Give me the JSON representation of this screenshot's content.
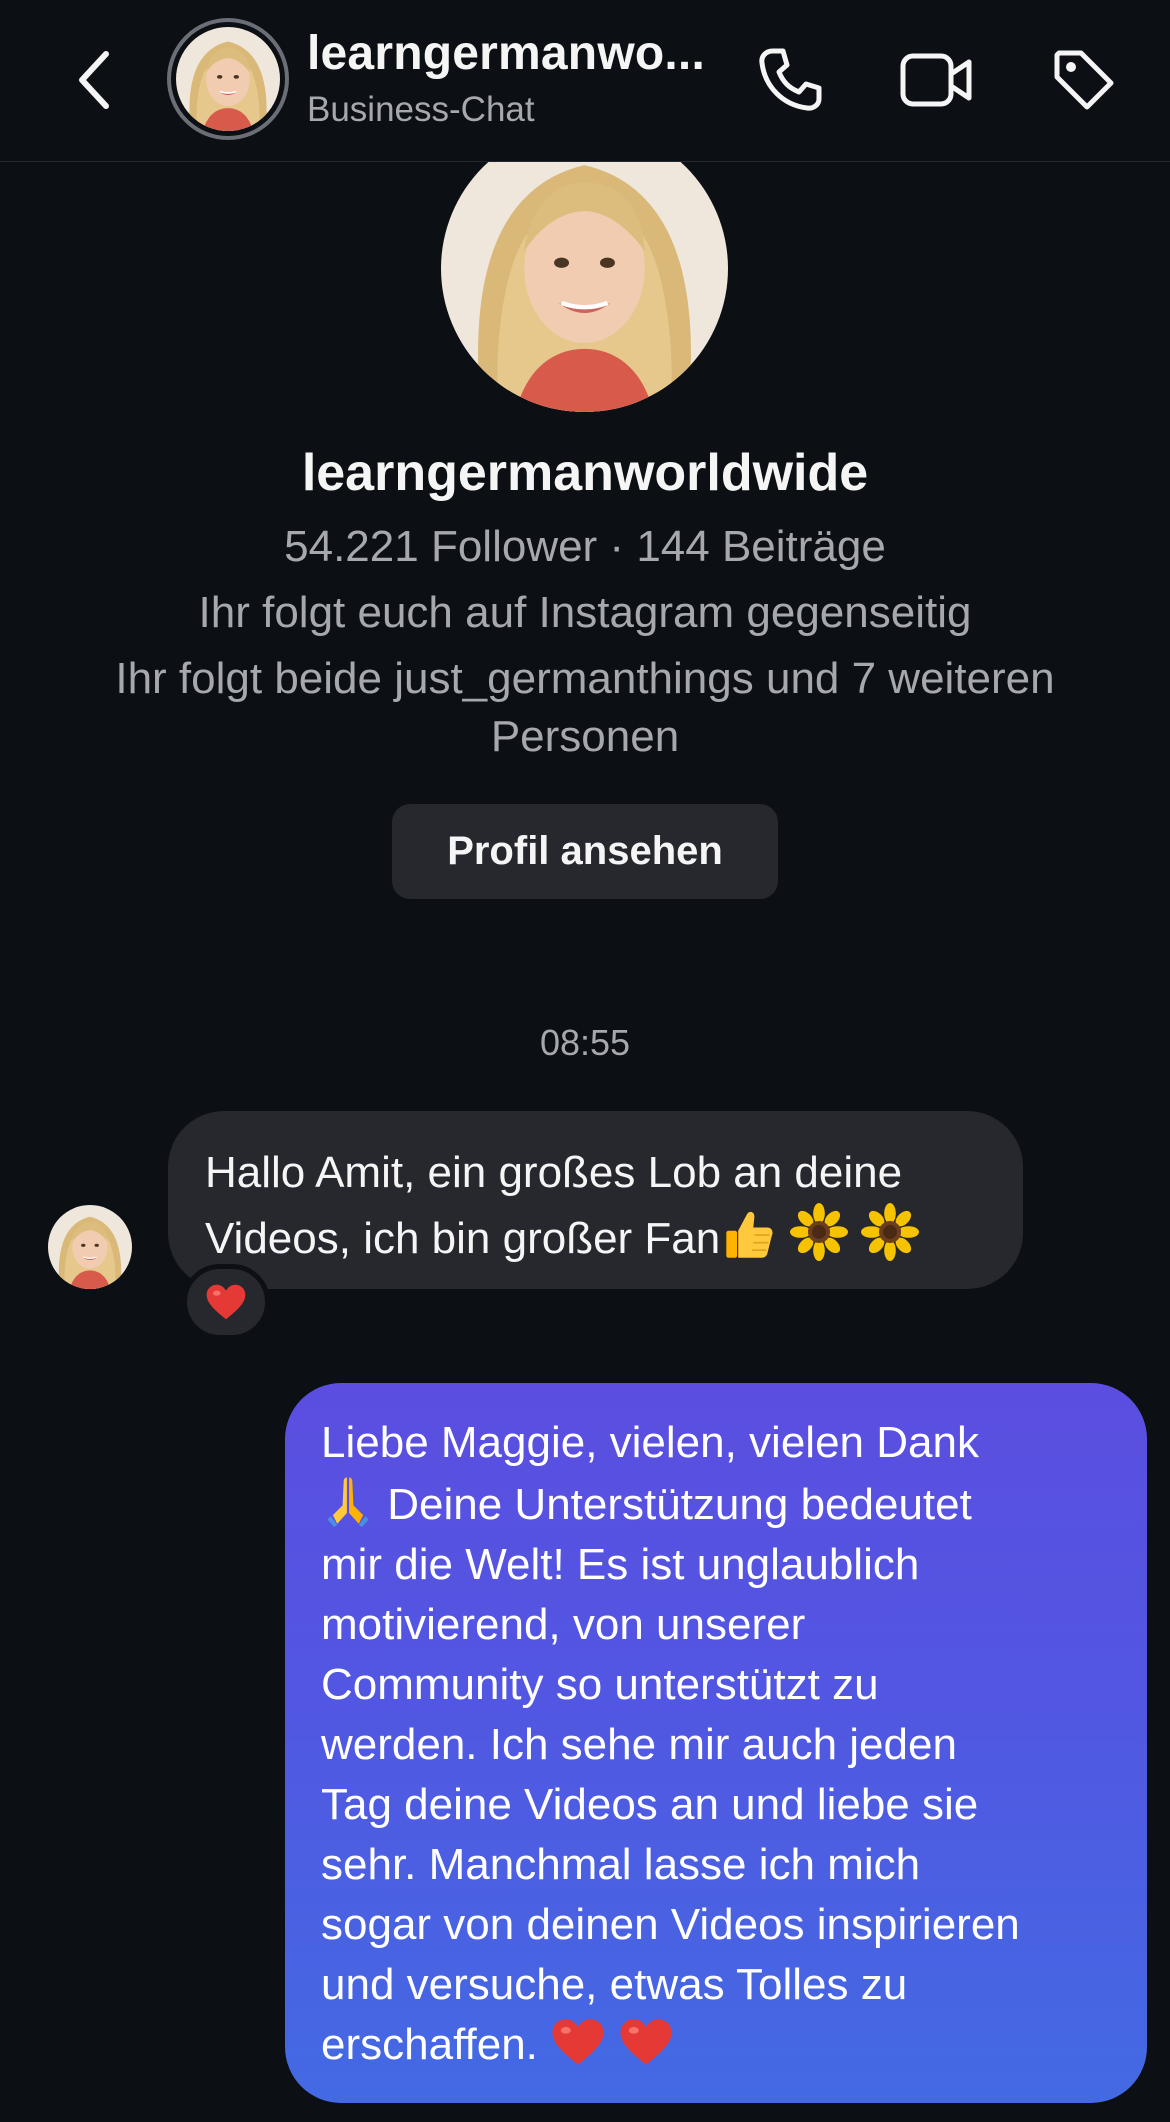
{
  "header": {
    "title": "learngermanwo...",
    "subtitle": "Business-Chat"
  },
  "profile": {
    "name": "learngermanworldwide",
    "stats": "54.221 Follower · 144 Beiträge",
    "mutual": "Ihr folgt euch auf Instagram gegenseitig",
    "common_1": "Ihr folgt beide just_germanthings und 7 weiteren",
    "common_2": "Personen",
    "view_profile_label": "Profil ansehen"
  },
  "chat": {
    "timestamp": "08:55",
    "incoming": {
      "line1": "Hallo Amit, ein großes Lob an deine",
      "line2": "Videos, ich bin großer Fan",
      "reaction": "heart"
    },
    "outgoing": {
      "line1": "Liebe Maggie, vielen, vielen Dank",
      "line2": " Deine Unterstützung bedeutet",
      "line3": "mir die Welt! Es ist unglaublich",
      "line4": "motivierend, von unserer",
      "line5": "Community so unterstützt zu",
      "line6": "werden. Ich sehe mir auch jeden",
      "line7": "Tag deine Videos an und liebe sie",
      "line8": "sehr. Manchmal lasse ich mich",
      "line9": "sogar von deinen Videos inspirieren",
      "line10": "und versuche, etwas Tolles zu",
      "line11": "erschaffen. "
    }
  },
  "icons": {
    "back": "chevron-left-icon",
    "call": "phone-icon",
    "video": "video-camera-icon",
    "label": "tag-icon"
  },
  "colors": {
    "background": "#0c0f14",
    "bubble_incoming": "#26282e",
    "bubble_outgoing_top": "#5b4ee0",
    "bubble_outgoing_bottom": "#436ae3",
    "secondary_text": "#a6a8ad"
  }
}
